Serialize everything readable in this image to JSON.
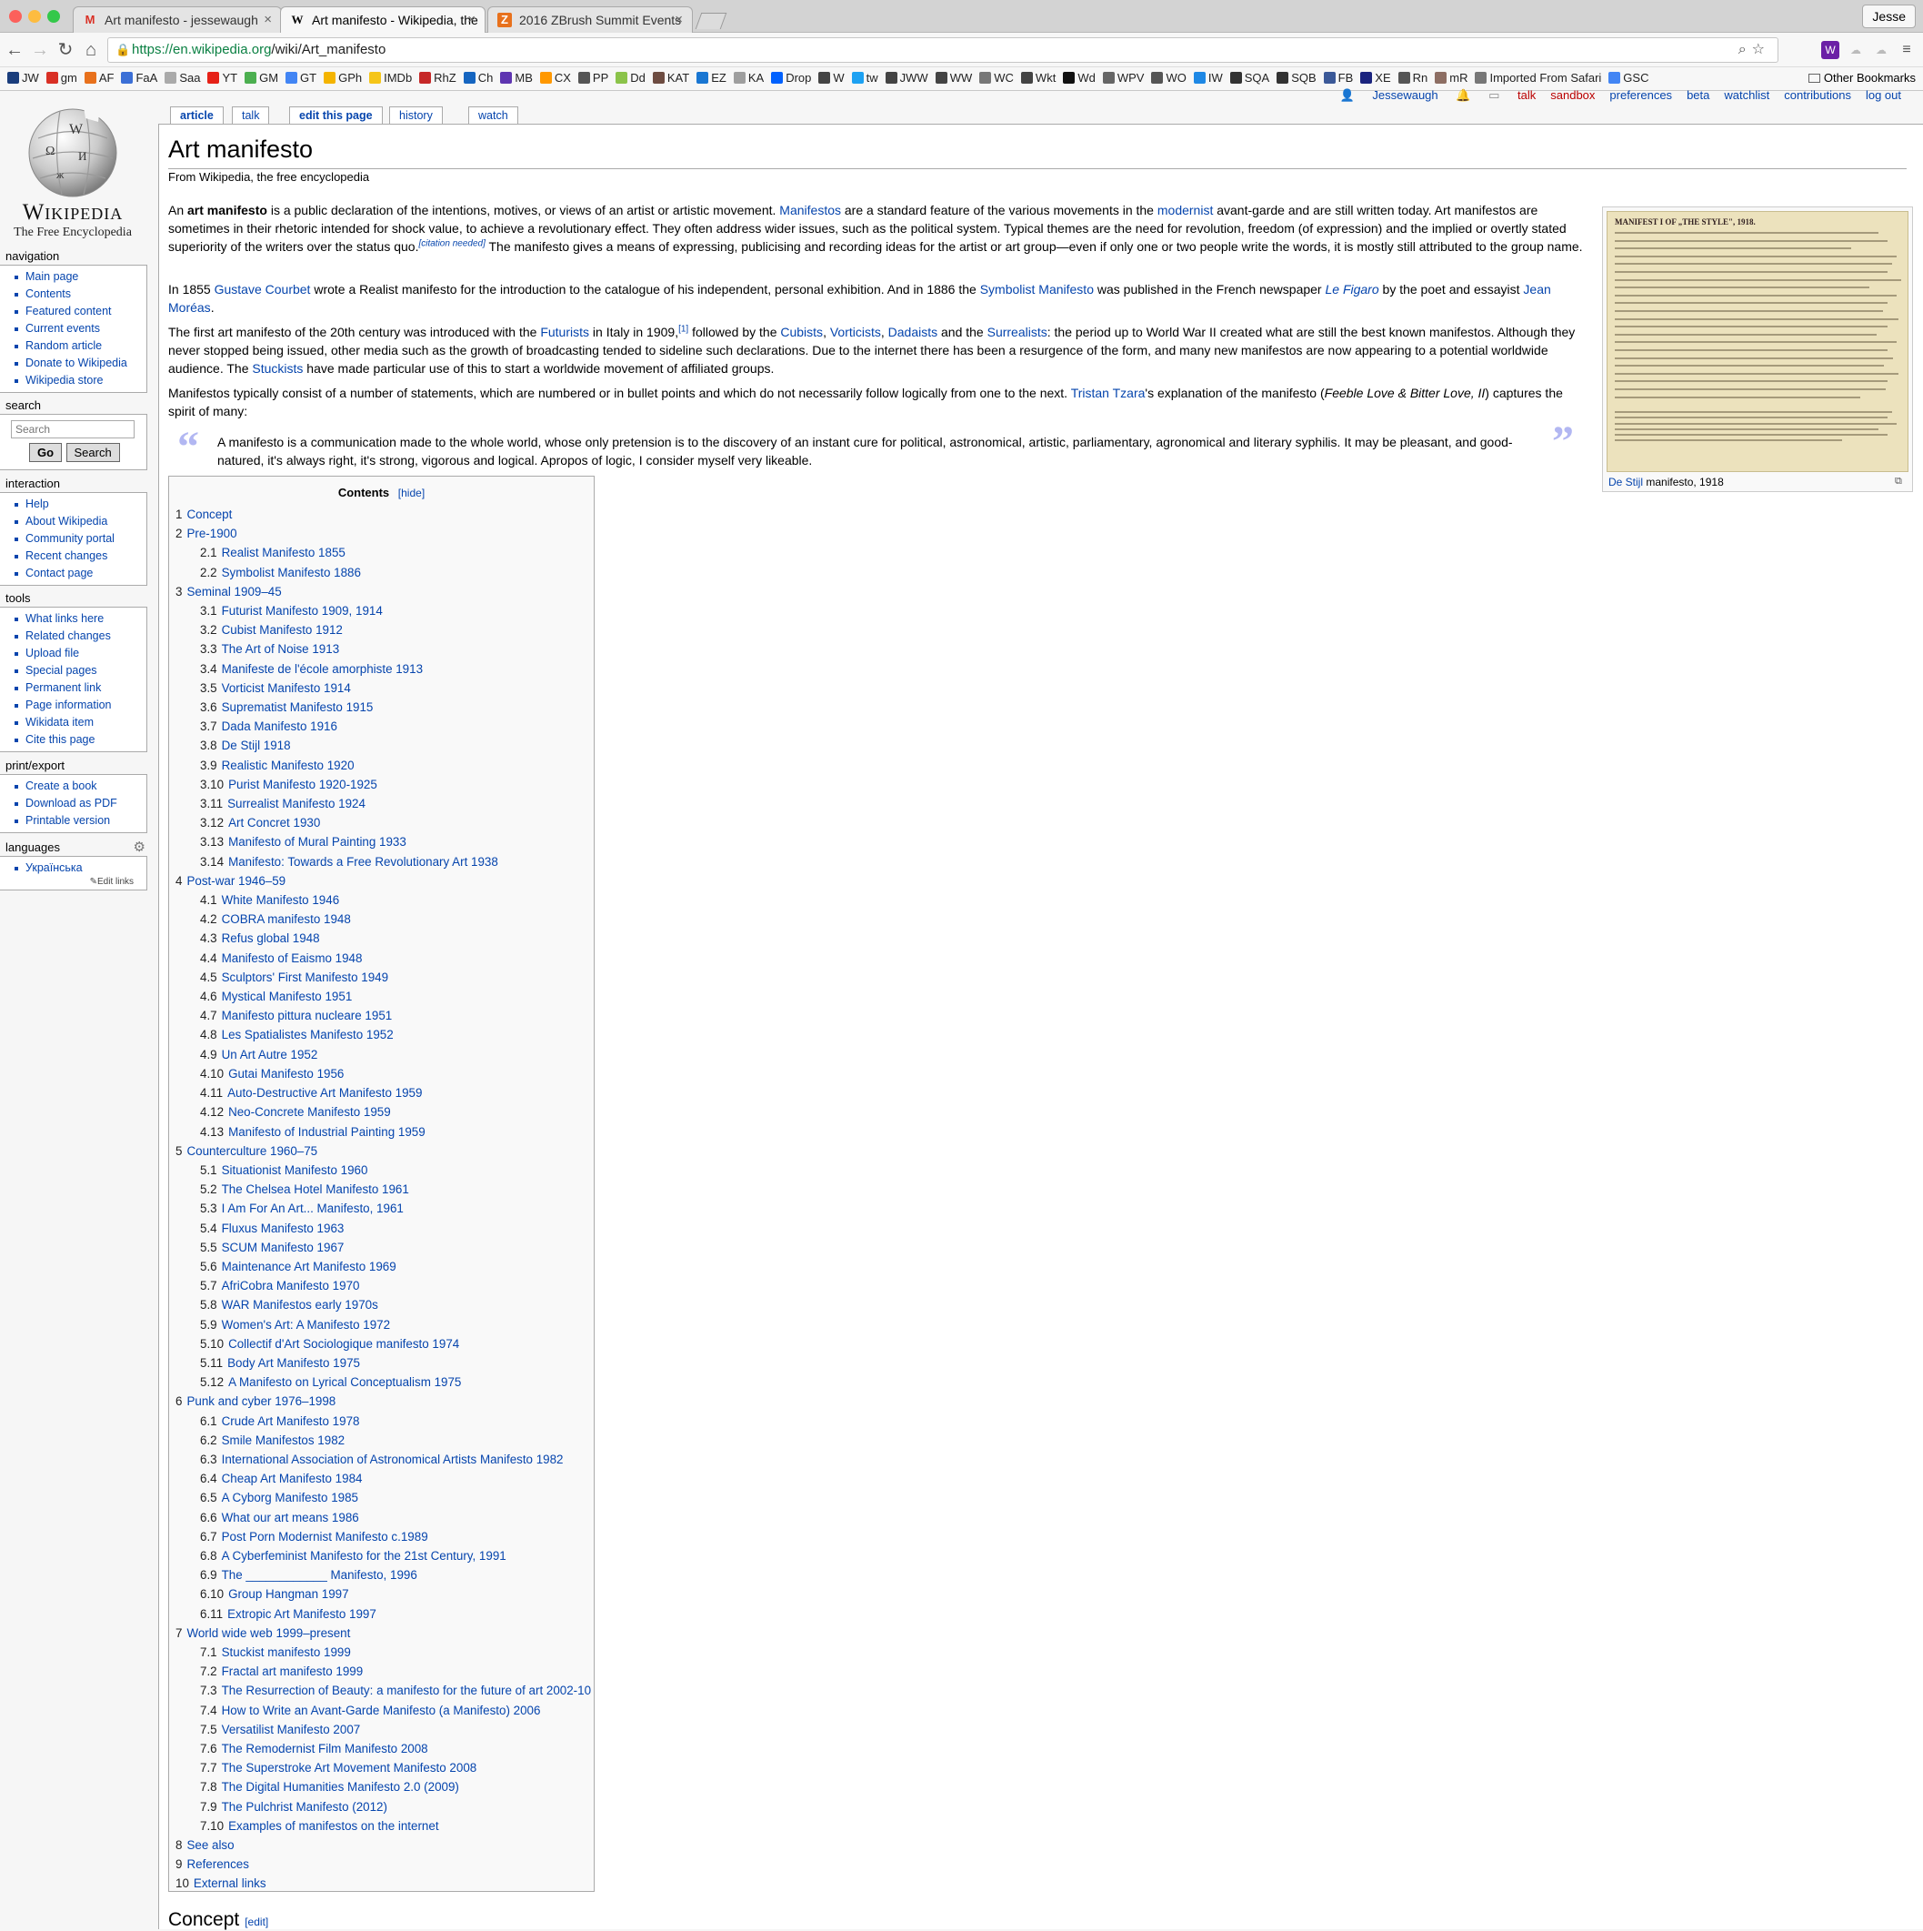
{
  "browser": {
    "tabs": [
      {
        "title": "Art manifesto - jessewaugh",
        "favicon": "M"
      },
      {
        "title": "Art manifesto - Wikipedia, the",
        "favicon": "W"
      },
      {
        "title": "2016 ZBrush Summit Events",
        "favicon": "Z"
      }
    ],
    "profile": "Jesse",
    "url_host": "https://en.wikipedia.org",
    "url_path": "/wiki/Art_manifesto",
    "bookmarks": [
      "JW",
      "gm",
      "AF",
      "FaA",
      "Saa",
      "YT",
      "GM",
      "GT",
      "GPh",
      "IMDb",
      "RhZ",
      "Ch",
      "MB",
      "CX",
      "PP",
      "Dd",
      "KAT",
      "EZ",
      "KA",
      "Drop",
      "W",
      "tw",
      "JWW",
      "WW",
      "WC",
      "Wkt",
      "Wd",
      "WPV",
      "WO",
      "IW",
      "SQA",
      "SQB",
      "FB",
      "XE",
      "Rn",
      "mR",
      "Imported From Safari",
      "GSC"
    ],
    "other_bookmarks": "Other Bookmarks"
  },
  "wiki": {
    "wordmark": "Wikipedia",
    "tagline": "The Free Encyclopedia",
    "personal": {
      "user": "Jessewaugh",
      "links": [
        "talk",
        "sandbox",
        "preferences",
        "beta",
        "watchlist",
        "contributions",
        "log out"
      ]
    },
    "page_tabs": [
      "article",
      "talk",
      "edit this page",
      "history",
      "watch"
    ],
    "navigation": {
      "heading": "navigation",
      "items": [
        "Main page",
        "Contents",
        "Featured content",
        "Current events",
        "Random article",
        "Donate to Wikipedia",
        "Wikipedia store"
      ]
    },
    "search": {
      "heading": "search",
      "placeholder": "Search",
      "go": "Go",
      "search": "Search"
    },
    "interaction": {
      "heading": "interaction",
      "items": [
        "Help",
        "About Wikipedia",
        "Community portal",
        "Recent changes",
        "Contact page"
      ]
    },
    "tools": {
      "heading": "tools",
      "items": [
        "What links here",
        "Related changes",
        "Upload file",
        "Special pages",
        "Permanent link",
        "Page information",
        "Wikidata item",
        "Cite this page"
      ]
    },
    "print": {
      "heading": "print/export",
      "items": [
        "Create a book",
        "Download as PDF",
        "Printable version"
      ]
    },
    "languages": {
      "heading": "languages",
      "items": [
        "Українська"
      ],
      "edit_links": "Edit links"
    }
  },
  "article": {
    "title": "Art manifesto",
    "subtitle": "From Wikipedia, the free encyclopedia",
    "p1": [
      {
        "t": "An "
      },
      {
        "t": "art manifesto",
        "b": true
      },
      {
        "t": " is a public declaration of the intentions, motives, or views of an artist or artistic movement. "
      },
      {
        "t": "Manifestos",
        "a": true
      },
      {
        "t": " are a standard feature of the various movements in the "
      },
      {
        "t": "modernist",
        "a": true
      },
      {
        "t": " avant-garde and are still written today. Art manifestos are sometimes in their rhetoric intended for shock value, to achieve a revolutionary effect. They often address wider issues, such as the political system. Typical themes are the need for revolution, freedom (of expression) and the implied or overtly stated superiority of the writers over the status quo."
      },
      {
        "t": "[citation needed]",
        "sup": true
      },
      {
        "t": " The manifesto gives a means of expressing, publicising and recording ideas for the artist or art group—even if only one or two people write the words, it is mostly still attributed to the group name."
      }
    ],
    "p2": [
      {
        "t": "In 1855 "
      },
      {
        "t": "Gustave Courbet",
        "a": true
      },
      {
        "t": " wrote a Realist manifesto for the introduction to the catalogue of his independent, personal exhibition. And in 1886 the "
      },
      {
        "t": "Symbolist Manifesto",
        "a": true
      },
      {
        "t": " was published in the French newspaper "
      },
      {
        "t": "Le Figaro",
        "a": true,
        "i": true
      },
      {
        "t": " by the poet and essayist "
      },
      {
        "t": "Jean Moréas",
        "a": true
      },
      {
        "t": "."
      }
    ],
    "p3": [
      {
        "t": "The first art manifesto of the 20th century was introduced with the "
      },
      {
        "t": "Futurists",
        "a": true
      },
      {
        "t": " in Italy in 1909,"
      },
      {
        "t": "[1]",
        "sup": true
      },
      {
        "t": " followed by the "
      },
      {
        "t": "Cubists",
        "a": true
      },
      {
        "t": ", "
      },
      {
        "t": "Vorticists",
        "a": true
      },
      {
        "t": ", "
      },
      {
        "t": "Dadaists",
        "a": true
      },
      {
        "t": " and the "
      },
      {
        "t": "Surrealists",
        "a": true
      },
      {
        "t": ": the period up to World War II created what are still the best known manifestos. Although they never stopped being issued, other media such as the growth of broadcasting tended to sideline such declarations. Due to the internet there has been a resurgence of the form, and many new manifestos are now appearing to a potential worldwide audience. The "
      },
      {
        "t": "Stuckists",
        "a": true
      },
      {
        "t": " have made particular use of this to start a worldwide movement of affiliated groups."
      }
    ],
    "p4": [
      {
        "t": "Manifestos typically consist of a number of statements, which are numbered or in bullet points and which do not necessarily follow logically from one to the next. "
      },
      {
        "t": "Tristan Tzara",
        "a": true
      },
      {
        "t": "'s explanation of the manifesto ("
      },
      {
        "t": "Feeble Love & Bitter Love, II",
        "i": true
      },
      {
        "t": ") captures the spirit of many:"
      }
    ],
    "quote": "A manifesto is a communication made to the whole world, whose only pretension is to the discovery of an instant cure for political, astronomical, artistic, parliamentary, agronomical and literary syphilis. It may be pleasant, and good-natured, it's always right, it's strong, vigorous and logical. Apropos of logic, I consider myself very likeable.",
    "image": {
      "heading": "MANIFEST I OF „THE STYLE\", 1918.",
      "caption_link": "De Stijl",
      "caption_rest": " manifesto, 1918"
    },
    "toc": {
      "title": "Contents",
      "hide": "[hide]",
      "items": [
        {
          "n": "1",
          "t": "Concept",
          "l": 1
        },
        {
          "n": "2",
          "t": "Pre-1900",
          "l": 1
        },
        {
          "n": "2.1",
          "t": "Realist Manifesto 1855",
          "l": 2
        },
        {
          "n": "2.2",
          "t": "Symbolist Manifesto 1886",
          "l": 2
        },
        {
          "n": "3",
          "t": "Seminal 1909–45",
          "l": 1
        },
        {
          "n": "3.1",
          "t": "Futurist Manifesto 1909, 1914",
          "l": 2
        },
        {
          "n": "3.2",
          "t": "Cubist Manifesto 1912",
          "l": 2
        },
        {
          "n": "3.3",
          "t": "The Art of Noise 1913",
          "l": 2
        },
        {
          "n": "3.4",
          "t": "Manifeste de l'école amorphiste 1913",
          "l": 2
        },
        {
          "n": "3.5",
          "t": "Vorticist Manifesto 1914",
          "l": 2
        },
        {
          "n": "3.6",
          "t": "Suprematist Manifesto 1915",
          "l": 2
        },
        {
          "n": "3.7",
          "t": "Dada Manifesto 1916",
          "l": 2
        },
        {
          "n": "3.8",
          "t": "De Stijl 1918",
          "l": 2
        },
        {
          "n": "3.9",
          "t": "Realistic Manifesto 1920",
          "l": 2
        },
        {
          "n": "3.10",
          "t": "Purist Manifesto 1920-1925",
          "l": 2
        },
        {
          "n": "3.11",
          "t": "Surrealist Manifesto 1924",
          "l": 2
        },
        {
          "n": "3.12",
          "t": "Art Concret 1930",
          "l": 2
        },
        {
          "n": "3.13",
          "t": "Manifesto of Mural Painting 1933",
          "l": 2
        },
        {
          "n": "3.14",
          "t": "Manifesto: Towards a Free Revolutionary Art 1938",
          "l": 2
        },
        {
          "n": "4",
          "t": "Post-war 1946–59",
          "l": 1
        },
        {
          "n": "4.1",
          "t": "White Manifesto 1946",
          "l": 2
        },
        {
          "n": "4.2",
          "t": "COBRA manifesto 1948",
          "l": 2
        },
        {
          "n": "4.3",
          "t": "Refus global 1948",
          "l": 2
        },
        {
          "n": "4.4",
          "t": "Manifesto of Eaismo 1948",
          "l": 2
        },
        {
          "n": "4.5",
          "t": "Sculptors' First Manifesto 1949",
          "l": 2
        },
        {
          "n": "4.6",
          "t": "Mystical Manifesto 1951",
          "l": 2
        },
        {
          "n": "4.7",
          "t": "Manifesto pittura nucleare 1951",
          "l": 2
        },
        {
          "n": "4.8",
          "t": "Les Spatialistes Manifesto 1952",
          "l": 2
        },
        {
          "n": "4.9",
          "t": "Un Art Autre 1952",
          "l": 2
        },
        {
          "n": "4.10",
          "t": "Gutai Manifesto 1956",
          "l": 2
        },
        {
          "n": "4.11",
          "t": "Auto-Destructive Art Manifesto 1959",
          "l": 2
        },
        {
          "n": "4.12",
          "t": "Neo-Concrete Manifesto 1959",
          "l": 2
        },
        {
          "n": "4.13",
          "t": "Manifesto of Industrial Painting 1959",
          "l": 2
        },
        {
          "n": "5",
          "t": "Counterculture 1960–75",
          "l": 1
        },
        {
          "n": "5.1",
          "t": "Situationist Manifesto 1960",
          "l": 2
        },
        {
          "n": "5.2",
          "t": "The Chelsea Hotel Manifesto 1961",
          "l": 2
        },
        {
          "n": "5.3",
          "t": "I Am For An Art... Manifesto, 1961",
          "l": 2
        },
        {
          "n": "5.4",
          "t": "Fluxus Manifesto 1963",
          "l": 2
        },
        {
          "n": "5.5",
          "t": "SCUM Manifesto 1967",
          "l": 2
        },
        {
          "n": "5.6",
          "t": "Maintenance Art Manifesto 1969",
          "l": 2
        },
        {
          "n": "5.7",
          "t": "AfriCobra Manifesto 1970",
          "l": 2
        },
        {
          "n": "5.8",
          "t": "WAR Manifestos early 1970s",
          "l": 2
        },
        {
          "n": "5.9",
          "t": "Women's Art: A Manifesto 1972",
          "l": 2
        },
        {
          "n": "5.10",
          "t": "Collectif d'Art Sociologique manifesto 1974",
          "l": 2
        },
        {
          "n": "5.11",
          "t": "Body Art Manifesto 1975",
          "l": 2
        },
        {
          "n": "5.12",
          "t": "A Manifesto on Lyrical Conceptualism 1975",
          "l": 2
        },
        {
          "n": "6",
          "t": "Punk and cyber 1976–1998",
          "l": 1
        },
        {
          "n": "6.1",
          "t": "Crude Art Manifesto 1978",
          "l": 2
        },
        {
          "n": "6.2",
          "t": "Smile Manifestos 1982",
          "l": 2
        },
        {
          "n": "6.3",
          "t": "International Association of Astronomical Artists Manifesto 1982",
          "l": 2
        },
        {
          "n": "6.4",
          "t": "Cheap Art Manifesto 1984",
          "l": 2
        },
        {
          "n": "6.5",
          "t": "A Cyborg Manifesto 1985",
          "l": 2
        },
        {
          "n": "6.6",
          "t": "What our art means 1986",
          "l": 2
        },
        {
          "n": "6.7",
          "t": "Post Porn Modernist Manifesto c.1989",
          "l": 2
        },
        {
          "n": "6.8",
          "t": "A Cyberfeminist Manifesto for the 21st Century, 1991",
          "l": 2
        },
        {
          "n": "6.9",
          "t": "The ____________ Manifesto, 1996",
          "l": 2
        },
        {
          "n": "6.10",
          "t": "Group Hangman 1997",
          "l": 2
        },
        {
          "n": "6.11",
          "t": "Extropic Art Manifesto 1997",
          "l": 2
        },
        {
          "n": "7",
          "t": "World wide web 1999–present",
          "l": 1
        },
        {
          "n": "7.1",
          "t": "Stuckist manifesto 1999",
          "l": 2
        },
        {
          "n": "7.2",
          "t": "Fractal art manifesto 1999",
          "l": 2
        },
        {
          "n": "7.3",
          "t": "The Resurrection of Beauty: a manifesto for the future of art 2002-10",
          "l": 2
        },
        {
          "n": "7.4",
          "t": "How to Write an Avant-Garde Manifesto (a Manifesto) 2006",
          "l": 2
        },
        {
          "n": "7.5",
          "t": "Versatilist Manifesto 2007",
          "l": 2
        },
        {
          "n": "7.6",
          "t": "The Remodernist Film Manifesto 2008",
          "l": 2
        },
        {
          "n": "7.7",
          "t": "The Superstroke Art Movement Manifesto 2008",
          "l": 2
        },
        {
          "n": "7.8",
          "t": "The Digital Humanities Manifesto 2.0 (2009)",
          "l": 2
        },
        {
          "n": "7.9",
          "t": "The Pulchrist Manifesto (2012)",
          "l": 2
        },
        {
          "n": "7.10",
          "t": "Examples of manifestos on the internet",
          "l": 2
        },
        {
          "n": "8",
          "t": "See also",
          "l": 1
        },
        {
          "n": "9",
          "t": "References",
          "l": 1
        },
        {
          "n": "10",
          "t": "External links",
          "l": 1
        }
      ]
    },
    "next_section": "Concept",
    "next_section_edit": "[edit]"
  }
}
